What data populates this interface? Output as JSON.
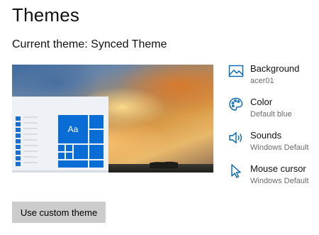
{
  "page": {
    "title": "Themes",
    "current_theme": "Current theme: Synced Theme"
  },
  "preview": {
    "tile_label": "Aa",
    "accent_color": "#0a6dd6"
  },
  "settings": [
    {
      "label": "Background",
      "value": "acer01",
      "icon": "picture-icon"
    },
    {
      "label": "Color",
      "value": "Default blue",
      "icon": "palette-icon"
    },
    {
      "label": "Sounds",
      "value": "Windows Default",
      "icon": "speaker-icon"
    },
    {
      "label": "Mouse cursor",
      "value": "Windows Default",
      "icon": "cursor-icon"
    }
  ],
  "actions": {
    "custom_theme_button": "Use custom theme"
  },
  "colors": {
    "icon_blue": "#0063b1",
    "button_gray": "#cccccc"
  }
}
